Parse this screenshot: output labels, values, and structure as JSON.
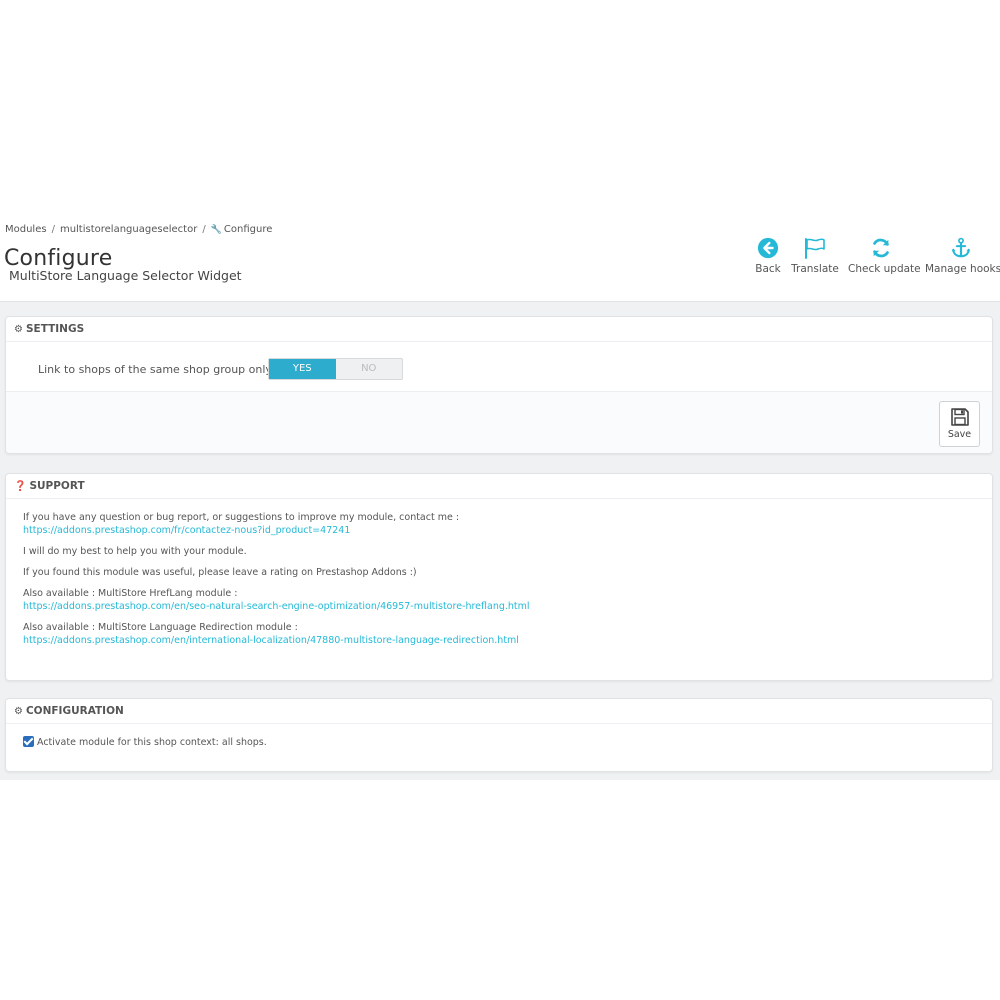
{
  "breadcrumb": {
    "items": [
      "Modules",
      "multistorelanguageselector"
    ],
    "current_icon": "wrench-icon",
    "current": "Configure",
    "separator": "/"
  },
  "page": {
    "title": "Configure",
    "subtitle": "MultiStore Language Selector Widget"
  },
  "toolbar": {
    "buttons": [
      {
        "label": "Back",
        "icon": "back-arrow-icon"
      },
      {
        "label": "Translate",
        "icon": "flag-icon"
      },
      {
        "label": "Check update",
        "icon": "refresh-icon"
      },
      {
        "label": "Manage hooks",
        "icon": "anchor-icon"
      }
    ],
    "icon_color": "#25b9d7"
  },
  "settings": {
    "heading": "SETTINGS",
    "heading_icon": "gears-icon",
    "field_label": "Link to shops of the same shop group only",
    "switch": {
      "yes": "YES",
      "no": "NO",
      "selected": "YES"
    },
    "save_label": "Save"
  },
  "support": {
    "heading": "SUPPORT",
    "heading_icon": "question-circle-icon",
    "p1_text": "If you have any question or bug report, or suggestions to improve my module, contact me :",
    "p1_link": "https://addons.prestashop.com/fr/contactez-nous?id_product=47241",
    "p2_text": "I will do my best to help you with your module.",
    "p3_text": "If you found this module was useful, please leave a rating on Prestashop Addons :)",
    "p4_text": "Also available : MultiStore HrefLang module :",
    "p4_link": "https://addons.prestashop.com/en/seo-natural-search-engine-optimization/46957-multistore-hreflang.html",
    "p5_text": "Also available : MultiStore Language Redirection module :",
    "p5_link": "https://addons.prestashop.com/en/international-localization/47880-multistore-language-redirection.html"
  },
  "configuration": {
    "heading": "CONFIGURATION",
    "heading_icon": "gears-icon",
    "checkbox_label": "Activate module for this shop context: all shops.",
    "checked": true
  },
  "colors": {
    "accent": "#25b9d7",
    "switch_on": "#2eacce",
    "background": "#eff1f2"
  }
}
